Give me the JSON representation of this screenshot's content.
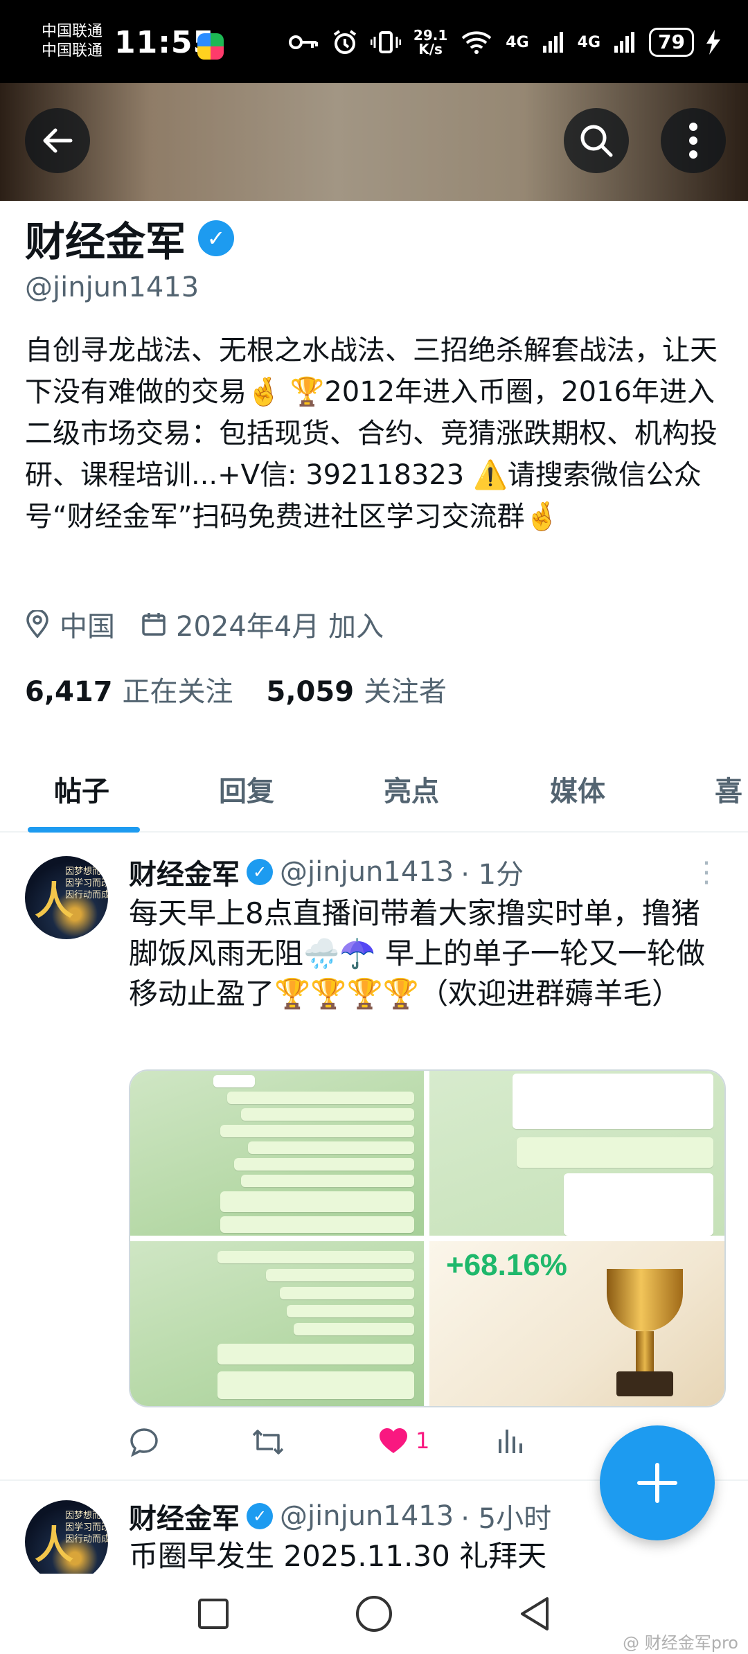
{
  "status_bar": {
    "carrier_1": "中国联通",
    "carrier_2": "中国联通",
    "time": "11:55",
    "speed_value": "29.1",
    "speed_unit": "K/s",
    "network_1": "4G",
    "network_2": "4G",
    "battery": "79"
  },
  "header": {
    "back_icon": "arrow-left-icon",
    "search_icon": "search-icon",
    "more_icon": "more-vertical-icon"
  },
  "profile": {
    "name": "财经金军",
    "handle": "@jinjun1413",
    "bio": "自创寻龙战法、无根之水战法、三招绝杀解套战法，让天下没有难做的交易🤞 🏆2012年进入币圈，2016年进入二级市场交易：包括现货、合约、竞猜涨跌期权、机构投研、课程培训...+V信: 392118323 ⚠️请搜索微信公众号“财经金军”扫码免费进社区学习交流群🤞",
    "location": "中国",
    "joined": "2024年4月 加入",
    "following_count": "6,417",
    "following_label": "正在关注",
    "followers_count": "5,059",
    "followers_label": "关注者"
  },
  "tabs": [
    {
      "label": "帖子",
      "active": true
    },
    {
      "label": "回复",
      "active": false
    },
    {
      "label": "亮点",
      "active": false
    },
    {
      "label": "媒体",
      "active": false
    },
    {
      "label": "喜",
      "active": false
    }
  ],
  "posts": [
    {
      "name": "财经金军",
      "handle": "@jinjun1413",
      "time": "· 1分",
      "text": "每天早上8点直播间带着大家撸实时单，撸猪脚饭风雨无阻🌧️☂️ 早上的单子一轮又一轮做移动止盈了🏆🏆🏆🏆（欢迎进群薅羊毛）",
      "media_percent_label": "+68.16%",
      "like_count": "1"
    },
    {
      "name": "财经金军",
      "handle": "@jinjun1413",
      "time": "· 5小时",
      "text": "币圈早发生 2025.11.30 礼拜天"
    }
  ],
  "avatar_text": "因梦想而伟大\n因学习而改变\n因行动而成功",
  "fab_icon": "plus-icon",
  "nav": {
    "recents": "square-icon",
    "home": "circle-icon",
    "back": "triangle-back-icon"
  },
  "watermark": "@ 财经金军pro",
  "colors": {
    "accent": "#1d9bf0",
    "like": "#f91880",
    "text": "#0f1419",
    "secondary": "#536471"
  }
}
